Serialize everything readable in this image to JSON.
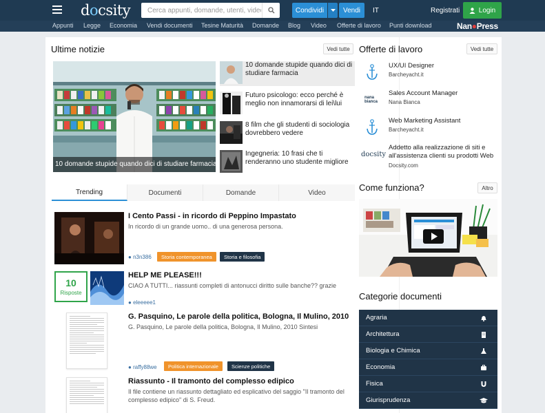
{
  "header": {
    "logo": "docsity",
    "search_placeholder": "Cerca appunti, domande, utenti, video",
    "share_label": "Condividi",
    "sell_label": "Vendi",
    "language": "IT",
    "register_label": "Registrati",
    "login_label": "Login"
  },
  "nav": {
    "items": [
      "Appunti",
      "Legge",
      "Economia",
      "Vendi documenti",
      "Tesine Maturità",
      "Domande",
      "Blog",
      "Video",
      "Offerte di lavoro",
      "Punti download"
    ],
    "brand": "NanoPress"
  },
  "news": {
    "title": "Ultime notizie",
    "see_all": "Vedi tutte",
    "featured_caption": "10 domande stupide quando dici di studiare farmacia",
    "items": [
      {
        "text": "10 domande stupide quando dici di studiare farmacia"
      },
      {
        "text": "Futuro psicologo: ecco perché è meglio non innamorarsi di lei\\lui"
      },
      {
        "text": "8 film che gli studenti di sociologia dovrebbero vedere"
      },
      {
        "text": "Ingegneria: 10 frasi che ti renderanno uno studente migliore"
      }
    ]
  },
  "tabs": [
    "Trending",
    "Documenti",
    "Domande",
    "Video"
  ],
  "feed": [
    {
      "title": "I Cento Passi - in ricordo di Peppino Impastato",
      "desc": "In ricordo di un grande uomo.. di una generosa persona.",
      "user": "n3n386",
      "tags": [
        "Storia contemporanea",
        "Storia e filosofia"
      ]
    },
    {
      "title": "HELP ME PLEASE!!!",
      "desc": "CIAO A TUTTI... riassunti completi di antonucci diritto sulle banche?? grazie",
      "user": "eleeeee1",
      "answers_count": "10",
      "answers_label": "Risposte"
    },
    {
      "title": "G. Pasquino, Le parole della politica, Bologna, Il Mulino, 2010",
      "desc": "G. Pasquino, Le parole della politica, Bologna, Il Mulino, 2010 Sintesi",
      "user": "raffy88we",
      "tags": [
        "Politica internazionale",
        "Scienze politiche"
      ]
    },
    {
      "title": "Riassunto - Il tramonto del complesso edipico",
      "desc": "Il file contiene un riassunto dettagliato ed esplicativo del saggio \"Il tramonto del complesso edipico\" di S. Freud."
    }
  ],
  "jobs": {
    "title": "Offerte di lavoro",
    "see_all": "Vedi tutte",
    "items": [
      {
        "title": "UX/UI Designer",
        "company": "Barcheyacht.it"
      },
      {
        "title": "Sales Account Manager",
        "company": "Nana Bianca"
      },
      {
        "title": "Web Marketing Assistant",
        "company": "Barcheyacht.it"
      },
      {
        "title": "Addetto alla realizzazione di siti e all'assistenza clienti su prodotti Web",
        "company": "Docsity.com"
      }
    ],
    "nana_logo": "nana bianca",
    "docsity_logo": "docsity"
  },
  "how": {
    "title": "Come funziona?",
    "other": "Altro"
  },
  "categories": {
    "title": "Categorie documenti",
    "items": [
      {
        "label": "Agraria",
        "icon": "bell-icon"
      },
      {
        "label": "Architettura",
        "icon": "building-icon"
      },
      {
        "label": "Biologia e Chimica",
        "icon": "flask-icon"
      },
      {
        "label": "Economia",
        "icon": "briefcase-icon"
      },
      {
        "label": "Fisica",
        "icon": "magnet-icon"
      },
      {
        "label": "Giurisprudenza",
        "icon": "graduation-cap-icon"
      }
    ]
  },
  "colors": {
    "header_bg": "#1f3a52",
    "accent_blue": "#2b8fd6",
    "login_green": "#2fa449",
    "tag_orange": "#f0932b",
    "tag_dark": "#203447"
  }
}
